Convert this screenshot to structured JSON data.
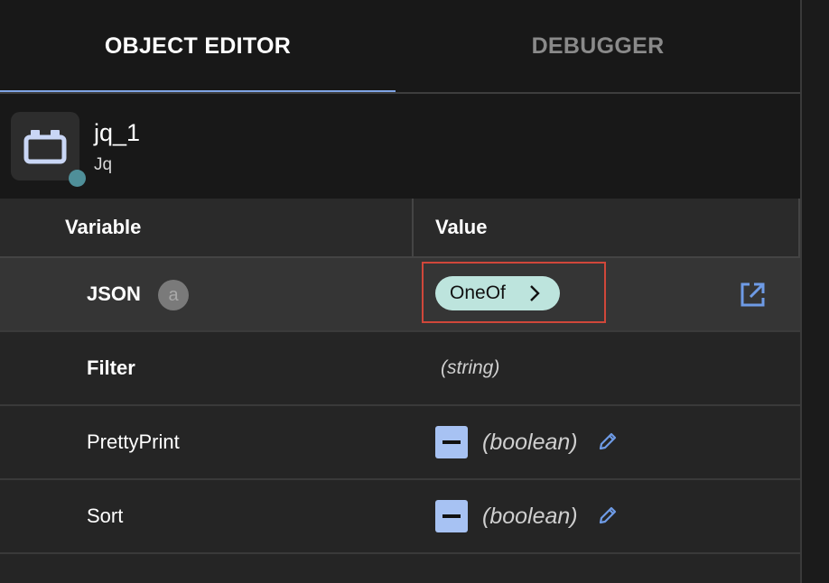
{
  "tabs": [
    {
      "label": "OBJECT EDITOR",
      "active": true
    },
    {
      "label": "DEBUGGER",
      "active": false
    }
  ],
  "object": {
    "name": "jq_1",
    "type": "Jq",
    "icon": "plugin-block-icon",
    "status_color": "#4f8f99"
  },
  "table": {
    "columns": {
      "variable": "Variable",
      "value": "Value"
    },
    "rows": [
      {
        "name": "JSON",
        "badge": "a",
        "value": "OneOf",
        "value_kind": "oneof",
        "action_icon": "open-in-new-icon"
      },
      {
        "name": "Filter",
        "value": "(string)",
        "value_kind": "string"
      },
      {
        "name": "PrettyPrint",
        "value": "(boolean)",
        "value_kind": "boolean",
        "action_icon": "pencil-icon"
      },
      {
        "name": "Sort",
        "value": "(boolean)",
        "value_kind": "boolean",
        "action_icon": "pencil-icon"
      }
    ]
  },
  "colors": {
    "accent": "#7fa4e4",
    "pill": "#bde4dd",
    "checkbox": "#a7c2f3",
    "highlight_border": "#d0473a"
  }
}
